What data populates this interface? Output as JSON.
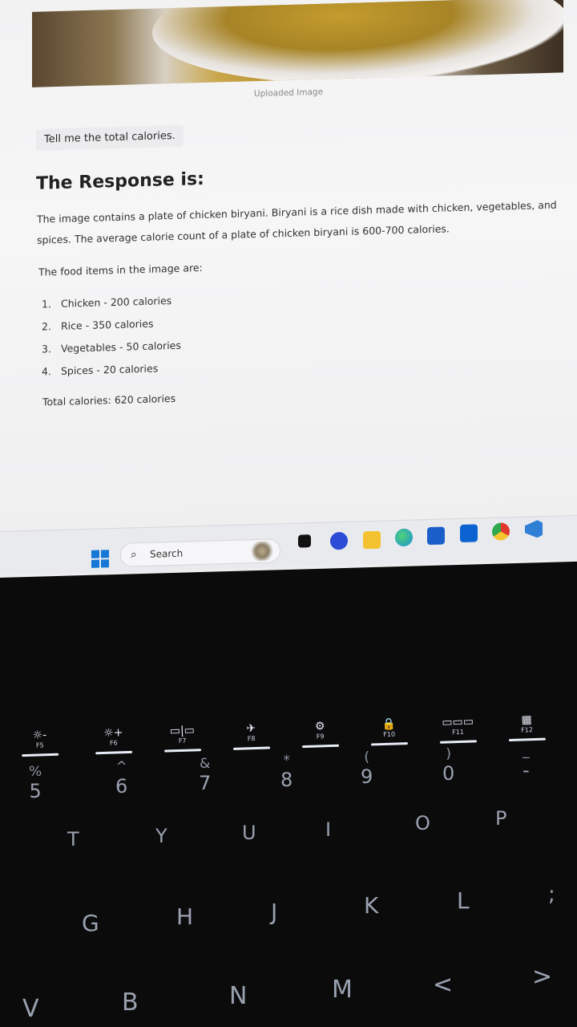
{
  "screen": {
    "image_caption": "Uploaded Image",
    "user_prompt": "Tell me the total calories.",
    "response_heading": "The Response is:",
    "response_line1": "The image contains a plate of chicken biryani. Biryani is a rice dish made with chicken, vegetables, and",
    "response_line2": "spices. The average calorie count of a plate of chicken biryani is 600-700 calories.",
    "items_intro": "The food items in the image are:",
    "food_items": [
      {
        "num": "1.",
        "text": "Chicken - 200 calories"
      },
      {
        "num": "2.",
        "text": "Rice - 350 calories"
      },
      {
        "num": "3.",
        "text": "Vegetables - 50 calories"
      },
      {
        "num": "4.",
        "text": "Spices - 20 calories"
      }
    ],
    "total": "Total calories: 620 calories"
  },
  "taskbar": {
    "search_label": "Search",
    "start_icon": "windows-logo-icon",
    "apps": [
      {
        "name": "widgets-icon",
        "color": "#111111"
      },
      {
        "name": "teams-chat-icon",
        "color": "#2c4bd6"
      },
      {
        "name": "file-explorer-icon",
        "color": "#f2c230"
      },
      {
        "name": "edge-icon",
        "color": "#1b8fd6"
      },
      {
        "name": "store-icon",
        "color": "#1a5fc9"
      },
      {
        "name": "outlook-icon",
        "color": "#0a63d1"
      },
      {
        "name": "chrome-icon",
        "color": "#e0382e"
      },
      {
        "name": "vscode-icon",
        "color": "#2f7fd6"
      }
    ]
  },
  "keyboard": {
    "fkeys": [
      {
        "label": "F5",
        "sym": "☼-"
      },
      {
        "label": "F6",
        "sym": "☼+"
      },
      {
        "label": "F7",
        "sym": "▭|▭"
      },
      {
        "label": "F8",
        "sym": "✈"
      },
      {
        "label": "F9",
        "sym": "⚙"
      },
      {
        "label": "F10",
        "sym": "🔒"
      },
      {
        "label": "F11",
        "sym": "▭▭▭"
      },
      {
        "label": "F12",
        "sym": "▦"
      }
    ],
    "numbers": [
      {
        "top": "%",
        "main": "5"
      },
      {
        "top": "^",
        "main": "6"
      },
      {
        "top": "&",
        "main": "7"
      },
      {
        "top": "*",
        "main": "8"
      },
      {
        "top": "(",
        "main": "9"
      },
      {
        "top": ")",
        "main": "0"
      },
      {
        "top": "_",
        "main": "-"
      }
    ],
    "row_top": [
      "T",
      "Y",
      "U",
      "I",
      "O",
      "P"
    ],
    "row_mid": [
      "G",
      "H",
      "J",
      "K",
      "L",
      ";"
    ],
    "row_bottom": [
      "V",
      "B",
      "N",
      "M",
      "<",
      ">"
    ]
  }
}
